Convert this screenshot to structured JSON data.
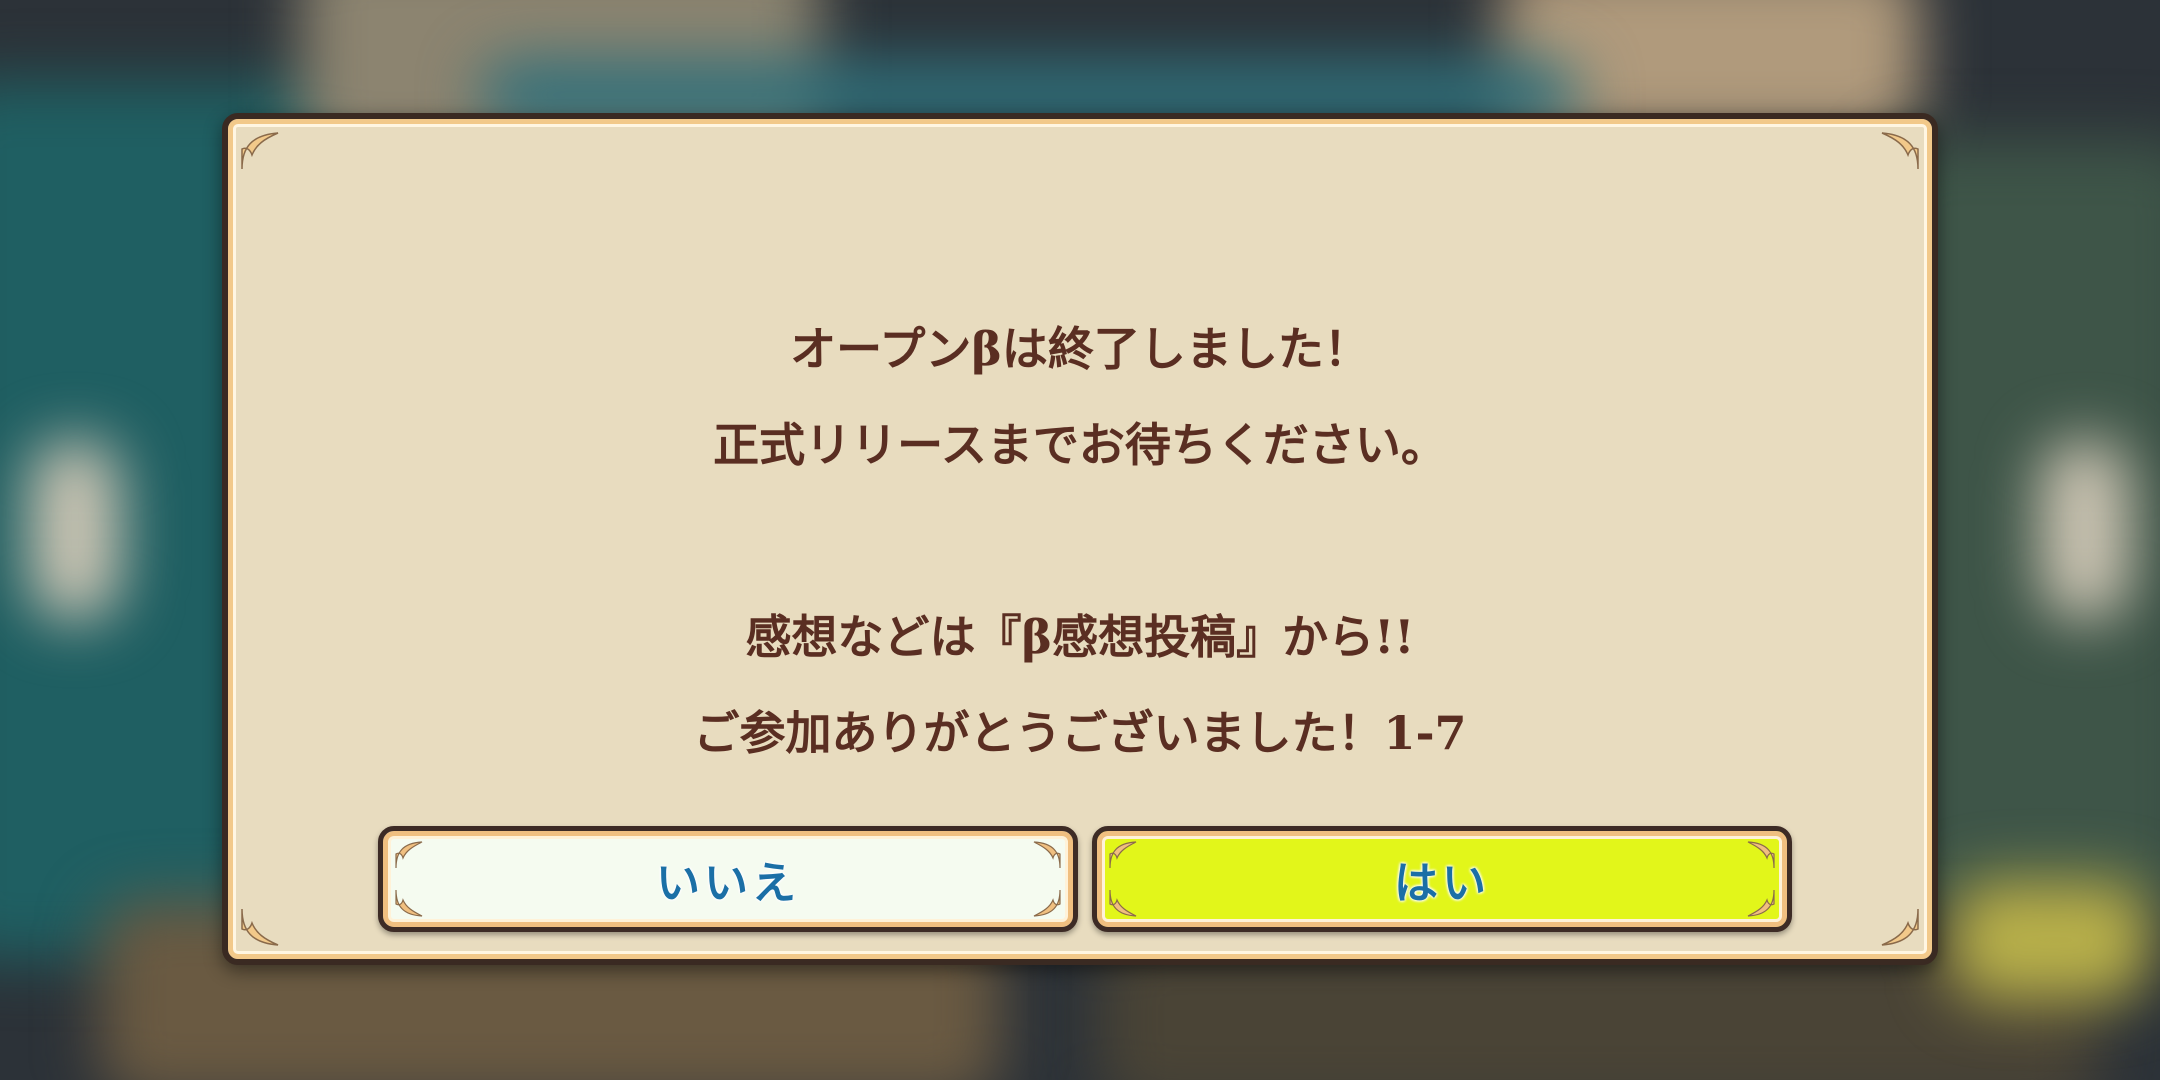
{
  "dialog": {
    "lines": [
      "オープンβは終了しました！",
      "正式リリースまでお待ちください。",
      "感想などは『β感想投稿』から!!",
      "ご参加ありがとうございました！1-7"
    ]
  },
  "buttons": {
    "no_label": "いいえ",
    "yes_label": "はい"
  },
  "colors": {
    "panel": "#e8dcbf",
    "text": "#5a2e22",
    "button_no": "#f5fbf0",
    "button_yes": "#e2f61a",
    "button_text": "#1b6fa6"
  },
  "icons": {
    "corner": "ornament-corner-icon"
  }
}
